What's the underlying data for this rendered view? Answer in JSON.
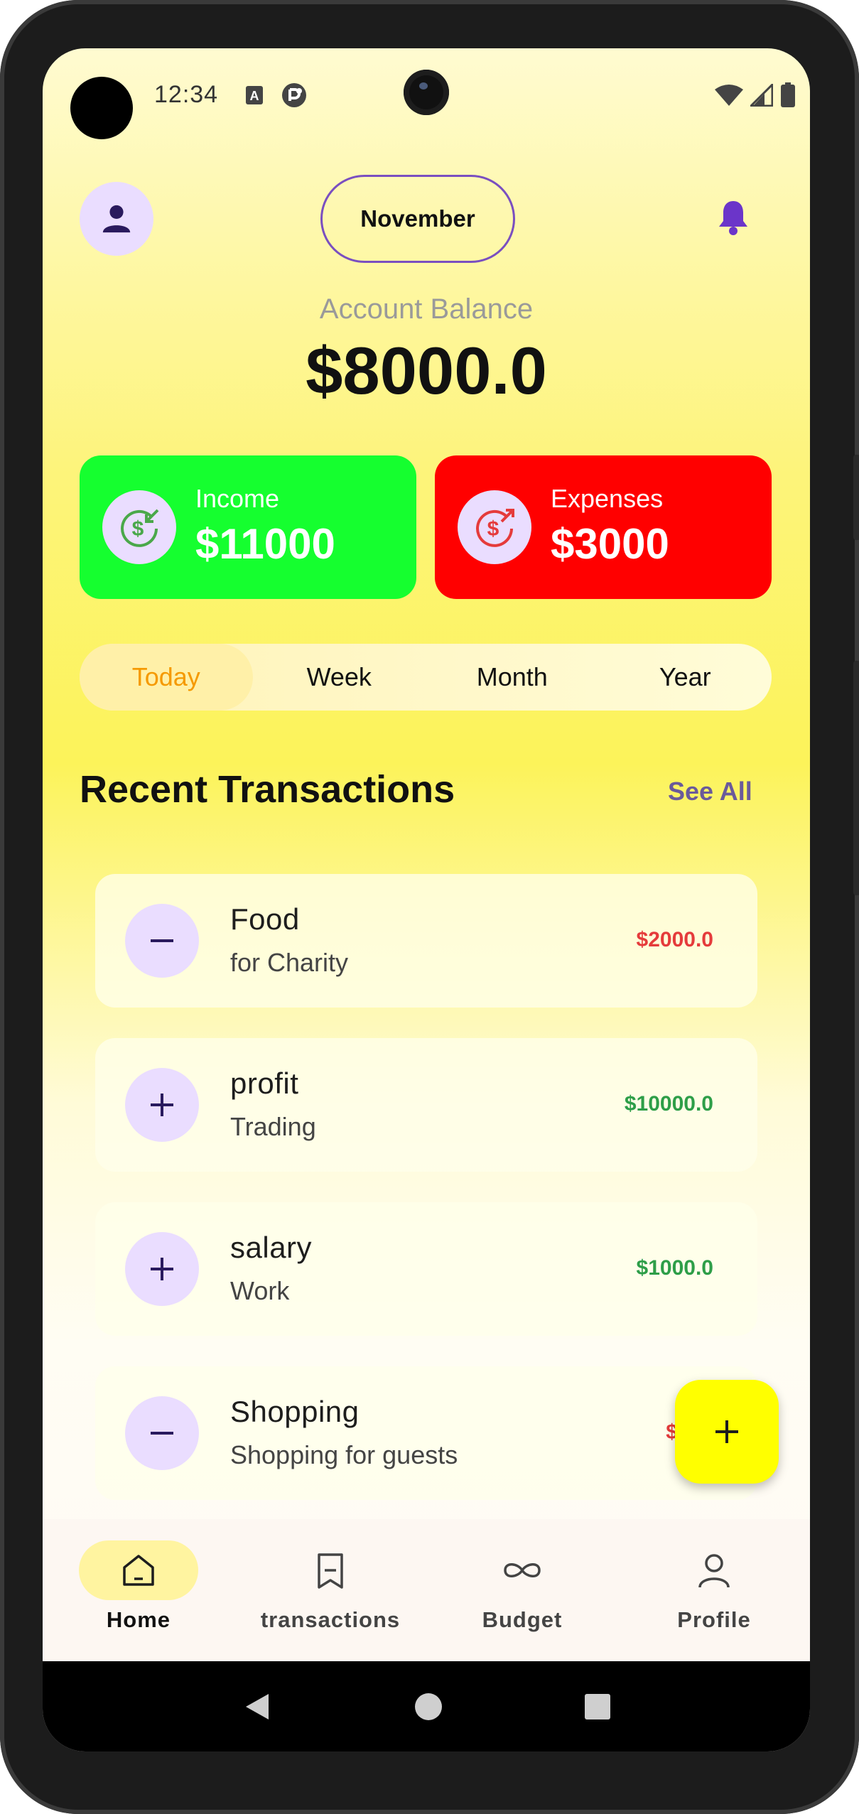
{
  "status_bar": {
    "time": "12:34"
  },
  "header": {
    "month": "November"
  },
  "balance": {
    "label": "Account Balance",
    "value": "$8000.0"
  },
  "income": {
    "label": "Income",
    "value": "$11000"
  },
  "expenses": {
    "label": "Expenses",
    "value": "$3000"
  },
  "periods": [
    "Today",
    "Week",
    "Month",
    "Year"
  ],
  "active_period": "Today",
  "recent": {
    "title": "Recent Transactions",
    "see_all": "See All",
    "items": [
      {
        "title": "Food",
        "subtitle": "for Charity",
        "amount": "$2000.0",
        "type": "expense"
      },
      {
        "title": "profit",
        "subtitle": "Trading",
        "amount": "$10000.0",
        "type": "income"
      },
      {
        "title": "salary",
        "subtitle": "Work",
        "amount": "$1000.0",
        "type": "income"
      },
      {
        "title": "Shopping",
        "subtitle": "Shopping for guests",
        "amount": "$100",
        "type": "expense"
      }
    ]
  },
  "nav": {
    "items": [
      {
        "label": "Home",
        "icon": "home-icon"
      },
      {
        "label": "transactions",
        "icon": "receipt-icon"
      },
      {
        "label": "Budget",
        "icon": "infinity-icon"
      },
      {
        "label": "Profile",
        "icon": "person-icon"
      }
    ],
    "active": "Home"
  },
  "colors": {
    "income_card": "#15ff2f",
    "expense_card": "#ff0000",
    "fab": "#ffff00",
    "accent_purple": "#7a4fc0",
    "amount_negative": "#e53b3b",
    "amount_positive": "#2e9e48"
  }
}
